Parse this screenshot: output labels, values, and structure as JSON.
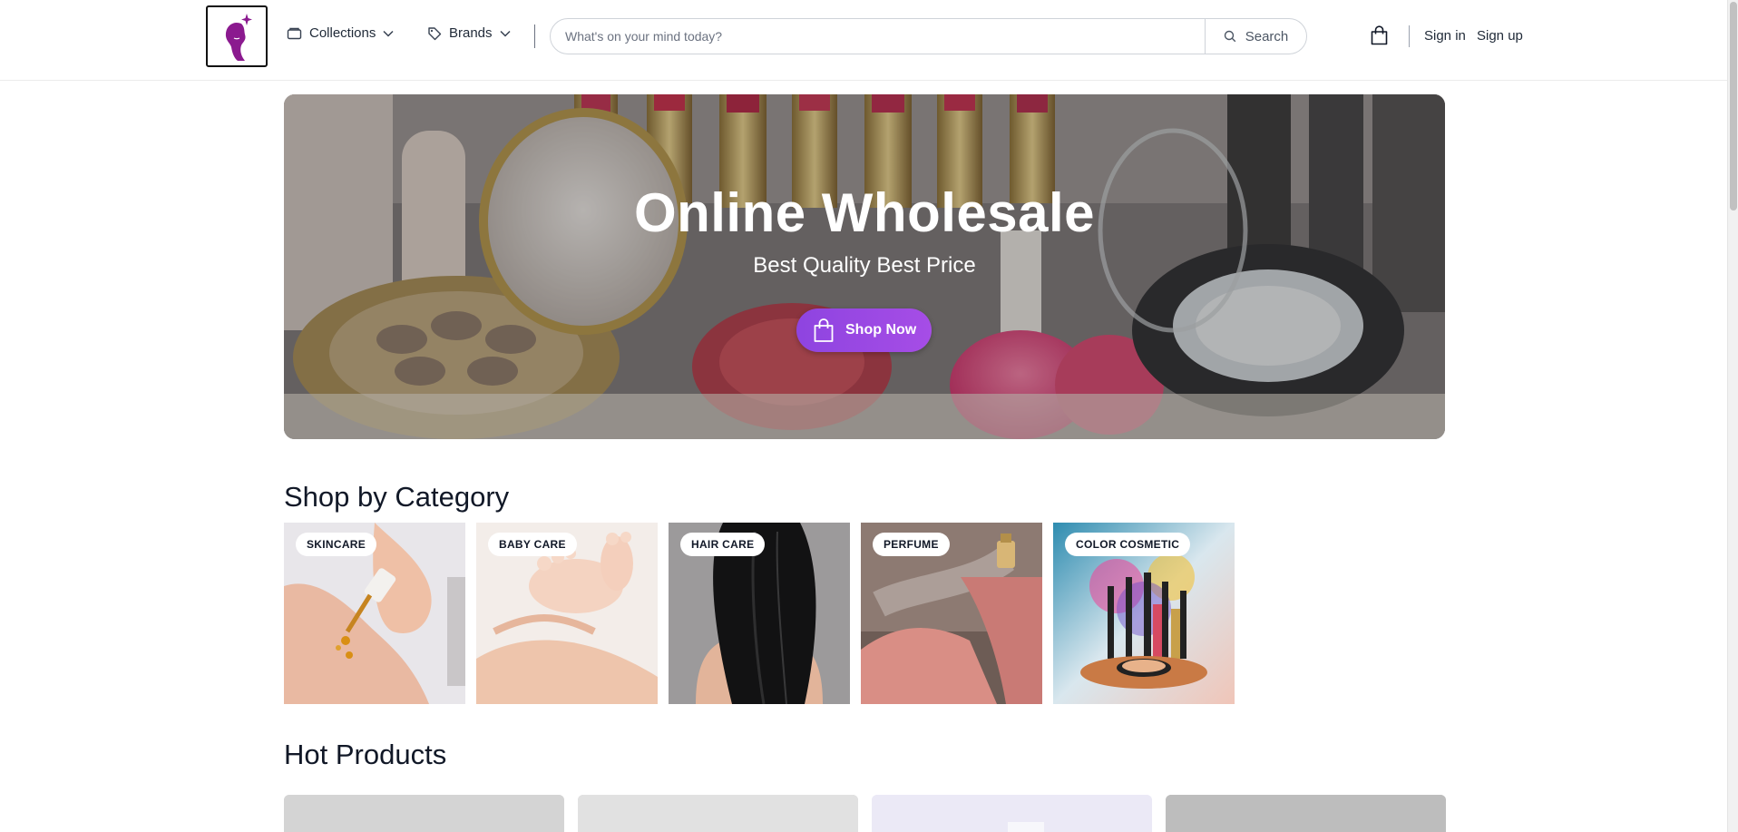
{
  "header": {
    "logo_alt": "Store logo",
    "nav": [
      {
        "label": "Collections"
      },
      {
        "label": "Brands"
      }
    ],
    "search": {
      "placeholder": "What's on your mind today?",
      "button_label": "Search"
    },
    "sign_in": "Sign in",
    "sign_up": "Sign up"
  },
  "hero": {
    "title": "Online Wholesale",
    "subtitle": "Best Quality Best Price",
    "cta_label": "Shop Now"
  },
  "categories": {
    "title": "Shop by Category",
    "items": [
      {
        "label": "SKINCARE"
      },
      {
        "label": "BABY CARE"
      },
      {
        "label": "HAIR CARE"
      },
      {
        "label": "PERFUME"
      },
      {
        "label": "COLOR COSMETIC"
      }
    ]
  },
  "hot_products": {
    "title": "Hot Products"
  },
  "colors": {
    "brand_purple": "#8b1a8f",
    "cta_gradient_start": "#8e44e0",
    "cta_gradient_end": "#a64de6"
  }
}
